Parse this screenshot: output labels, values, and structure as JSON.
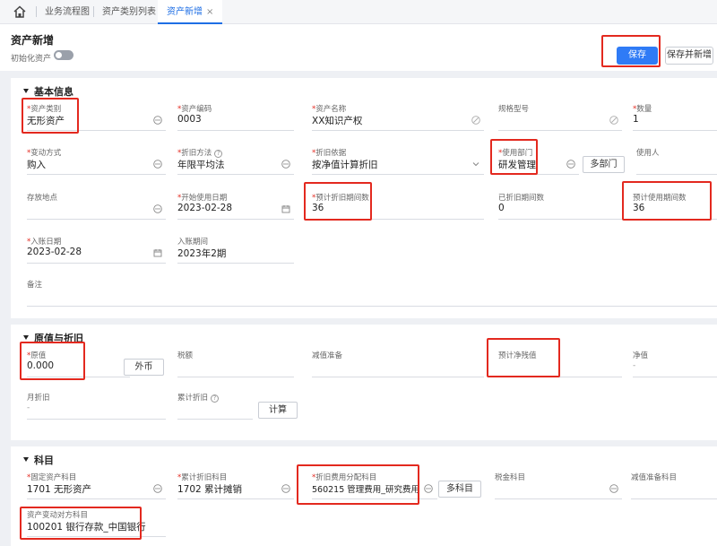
{
  "tabs": {
    "items": [
      {
        "label": "业务流程图"
      },
      {
        "label": "资产类别列表"
      },
      {
        "label": "资产新增",
        "close": "×"
      }
    ]
  },
  "header": {
    "title": "资产新增",
    "init_label": "初始化资产",
    "save_label": "保存",
    "save_new_label": "保存并新增"
  },
  "basic": {
    "title": "基本信息",
    "asset_category": {
      "label": "资产类别",
      "value": "无形资产"
    },
    "asset_code": {
      "label": "资产编码",
      "value": "0003"
    },
    "asset_name": {
      "label": "资产名称",
      "value": "XX知识产权"
    },
    "spec_model": {
      "label": "规格型号",
      "value": ""
    },
    "quantity": {
      "label": "数量",
      "value": "1"
    },
    "change_method": {
      "label": "变动方式",
      "value": "购入"
    },
    "depr_method": {
      "label": "折旧方法",
      "value": "年限平均法"
    },
    "depr_basis": {
      "label": "折旧依据",
      "value": "按净值计算折旧"
    },
    "use_dept": {
      "label": "使用部门",
      "value": "研发管理"
    },
    "multi_dept_label": "多部门",
    "user": {
      "label": "使用人",
      "value": ""
    },
    "location": {
      "label": "存放地点",
      "value": ""
    },
    "start_date": {
      "label": "开始使用日期",
      "value": "2023-02-28"
    },
    "est_depr_periods": {
      "label": "预计折旧期间数",
      "value": "36"
    },
    "depr_periods_done": {
      "label": "已折旧期间数",
      "value": "0"
    },
    "est_use_periods": {
      "label": "预计使用期间数",
      "value": "36"
    },
    "entry_date": {
      "label": "入账日期",
      "value": "2023-02-28"
    },
    "entry_period": {
      "label": "入账期间",
      "value": "2023年2期"
    },
    "remark": {
      "label": "备注",
      "value": ""
    }
  },
  "value": {
    "title": "原值与折旧",
    "original": {
      "label": "原值",
      "value": "0.000"
    },
    "foreign_label": "外币",
    "tax": {
      "label": "税额",
      "value": ""
    },
    "impairment": {
      "label": "减值准备",
      "value": ""
    },
    "est_residual": {
      "label": "预计净残值",
      "value": ""
    },
    "net_value": {
      "label": "净值",
      "value": "-"
    },
    "monthly_depr": {
      "label": "月折旧",
      "value": "-"
    },
    "accum_depr": {
      "label": "累计折旧",
      "value": ""
    },
    "calc_label": "计算"
  },
  "subject": {
    "title": "科目",
    "fixed_asset": {
      "label": "固定资产科目",
      "value": "1701 无形资产"
    },
    "accum_depr": {
      "label": "累计折旧科目",
      "value": "1702 累计摊销"
    },
    "depr_alloc": {
      "label": "折旧费用分配科目",
      "value": "560215 管理费用_研究费用"
    },
    "multi_subject_label": "多科目",
    "tax_subject": {
      "label": "税金科目",
      "value": ""
    },
    "impairment_subject": {
      "label": "减值准备科目",
      "value": ""
    },
    "change_contra": {
      "label": "资产变动对方科目",
      "value": "100201 银行存款_中国银行"
    }
  },
  "colors": {
    "accent": "#2f7bf6",
    "highlight": "#e3291f",
    "required": "#e3291f"
  }
}
